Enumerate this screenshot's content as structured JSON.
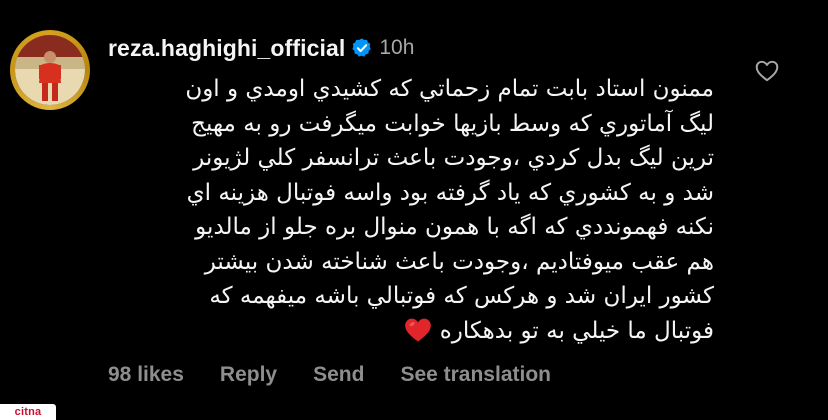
{
  "comment": {
    "username": "reza.haghighi_official",
    "time": "10h",
    "verified": true,
    "lines": [
      "ممنون استاد بابت تمام زحماتي كه كشيدي اومدي و اون",
      "ليگ آماتوري كه وسط بازيها خوابت ميگرفت رو به مهيج",
      "ترين ليگ بدل كردي ،وجودت باعث ترانسفر كلي لژيونر",
      "شد و به كشوري كه ياد گرفته بود واسه فوتبال هزينه اي",
      "نكنه فهمونددي كه اگه با همون منوال بره جلو از مالديو",
      "هم عقب ميوفتاديم ،وجودت باعث شناخته شدن بيشتر",
      "كشور ايران شد و هركس كه فوتبالي باشه ميفهمه كه",
      "فوتبال ما خيلي به تو بدهكاره"
    ],
    "actions": {
      "likes": "98 likes",
      "reply": "Reply",
      "send": "Send",
      "translate": "See translation"
    }
  },
  "icons": {
    "like": "heart-outline-icon",
    "verified": "verified-badge-icon",
    "emoji": "red-heart-emoji"
  },
  "colors": {
    "background": "#000000",
    "text": "#f5f5f5",
    "muted": "#8e8e8e",
    "verified": "#0095f6",
    "heart": "#e0262b",
    "watermark_text": "#c8102e"
  },
  "watermark": "citna"
}
